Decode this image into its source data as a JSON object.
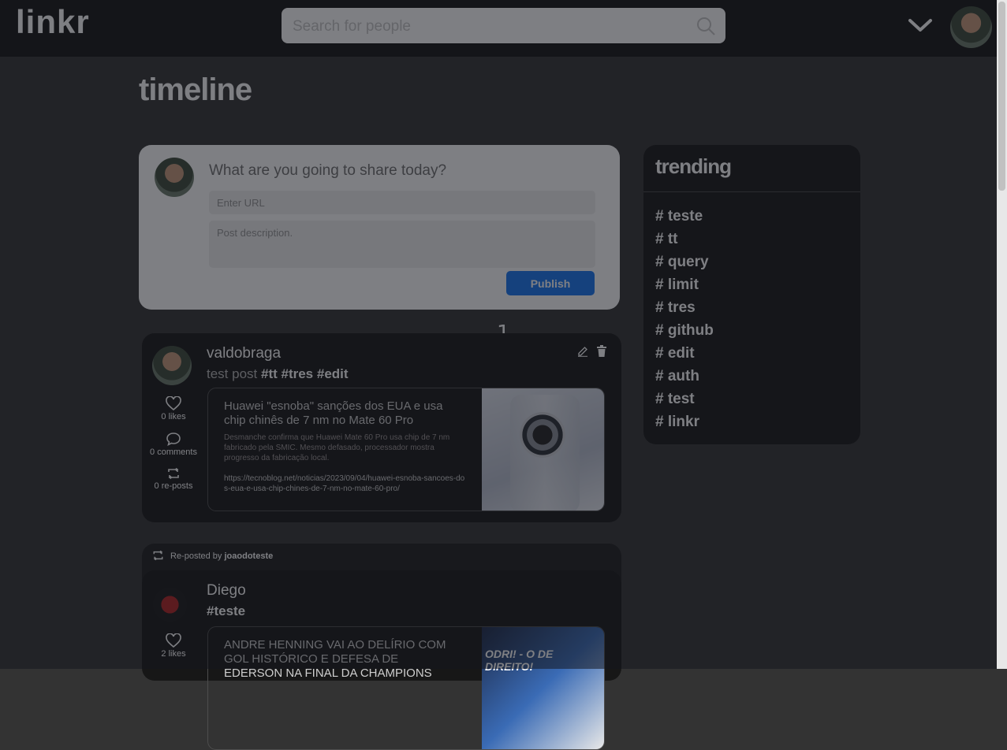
{
  "header": {
    "logo": "linkr",
    "search_placeholder": "Search for people"
  },
  "page": {
    "title": "timeline"
  },
  "publish": {
    "question": "What are you going to share today?",
    "url_placeholder": "Enter URL",
    "description_placeholder": "Post description.",
    "button_label": "Publish"
  },
  "new_posts_count": "1",
  "posts": [
    {
      "username": "valdobraga",
      "text": "test post",
      "hashtags": "#tt #tres #edit",
      "likes": "0 likes",
      "comments": "0 comments",
      "reposts": "0 re-posts",
      "link": {
        "title": "Huawei \"esnoba\" sanções dos EUA e usa chip chinês de 7 nm no Mate 60 Pro",
        "description": "Desmanche confirma que Huawei Mate 60 Pro usa chip de 7 nm fabricado pela SMIC. Mesmo defasado, processador mostra progresso da fabricação local.",
        "url": "https://tecnoblog.net/noticias/2023/09/04/huawei-esnoba-sancoes-dos-eua-e-usa-chip-chines-de-7-nm-no-mate-60-pro/"
      }
    },
    {
      "repost_label": "Re-posted by",
      "repost_user": "joaodoteste",
      "username": "Diego",
      "hashtags": "#teste",
      "likes": "2 likes",
      "link": {
        "title": "ANDRE HENNING VAI AO DELÍRIO COM GOL HISTÓRICO E DEFESA DE EDERSON NA FINAL DA CHAMPIONS",
        "image_text": "ODRI! - O DE DIREITO!"
      }
    }
  ],
  "trending": {
    "title": "trending",
    "hashtags": [
      "# teste",
      "# tt",
      "# query",
      "# limit",
      "# tres",
      "# github",
      "# edit",
      "# auth",
      "# test",
      "# linkr"
    ]
  },
  "colors": {
    "background": "#333333",
    "topbar": "#151515",
    "card": "#171717",
    "accent": "#1877f2"
  }
}
